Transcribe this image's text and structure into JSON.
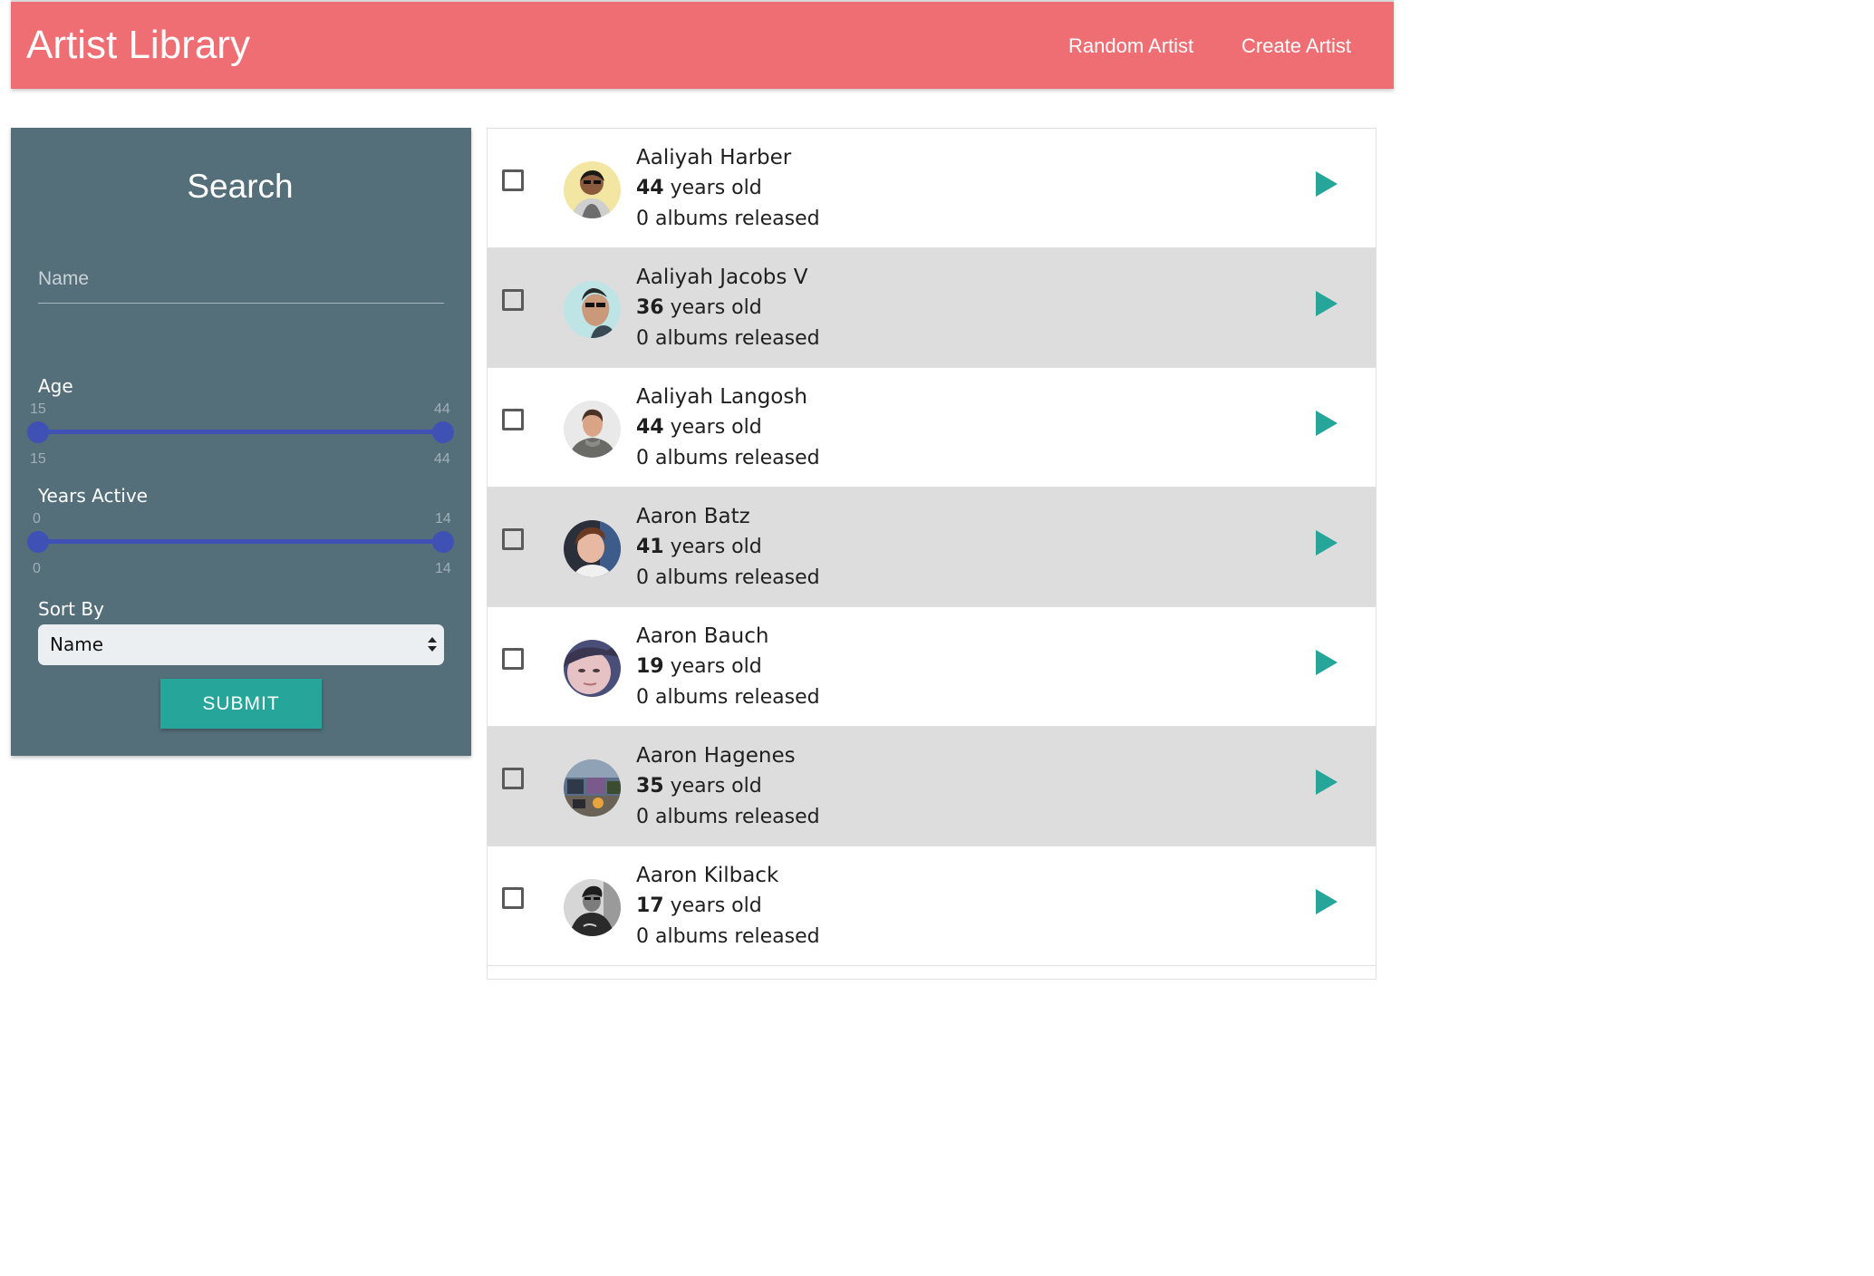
{
  "header": {
    "brand": "Artist Library",
    "nav": {
      "random_artist": "Random Artist",
      "create_artist": "Create Artist"
    },
    "bar_color": "#ef6e73"
  },
  "search": {
    "title": "Search",
    "name_placeholder": "Name",
    "age": {
      "label": "Age",
      "min_label": "15",
      "max_label": "44",
      "min_value": "15",
      "max_value": "44"
    },
    "years_active": {
      "label": "Years Active",
      "min_label": "0",
      "max_label": "14",
      "min_value": "0",
      "max_value": "14"
    },
    "sort_by": {
      "label": "Sort By",
      "selected": "Name"
    },
    "submit_label": "SUBMIT",
    "panel_color": "#546e7a",
    "slider_color": "#3f51b5",
    "button_color": "#26a69a"
  },
  "artists": [
    {
      "name": "Aaliyah Harber",
      "age": "44",
      "age_suffix": " years old",
      "albums": "0 albums released",
      "avatar": "avatar-photo"
    },
    {
      "name": "Aaliyah Jacobs V",
      "age": "36",
      "age_suffix": " years old",
      "albums": "0 albums released",
      "avatar": "avatar-photo"
    },
    {
      "name": "Aaliyah Langosh",
      "age": "44",
      "age_suffix": " years old",
      "albums": "0 albums released",
      "avatar": "avatar-photo"
    },
    {
      "name": "Aaron Batz",
      "age": "41",
      "age_suffix": " years old",
      "albums": "0 albums released",
      "avatar": "avatar-photo"
    },
    {
      "name": "Aaron Bauch",
      "age": "19",
      "age_suffix": " years old",
      "albums": "0 albums released",
      "avatar": "avatar-photo"
    },
    {
      "name": "Aaron Hagenes",
      "age": "35",
      "age_suffix": " years old",
      "albums": "0 albums released",
      "avatar": "avatar-photo"
    },
    {
      "name": "Aaron Kilback",
      "age": "17",
      "age_suffix": " years old",
      "albums": "0 albums released",
      "avatar": "avatar-photo"
    }
  ],
  "row_colors": {
    "even": "#ffffff",
    "odd": "#dddddd"
  },
  "play_icon_color": "#26a69a"
}
